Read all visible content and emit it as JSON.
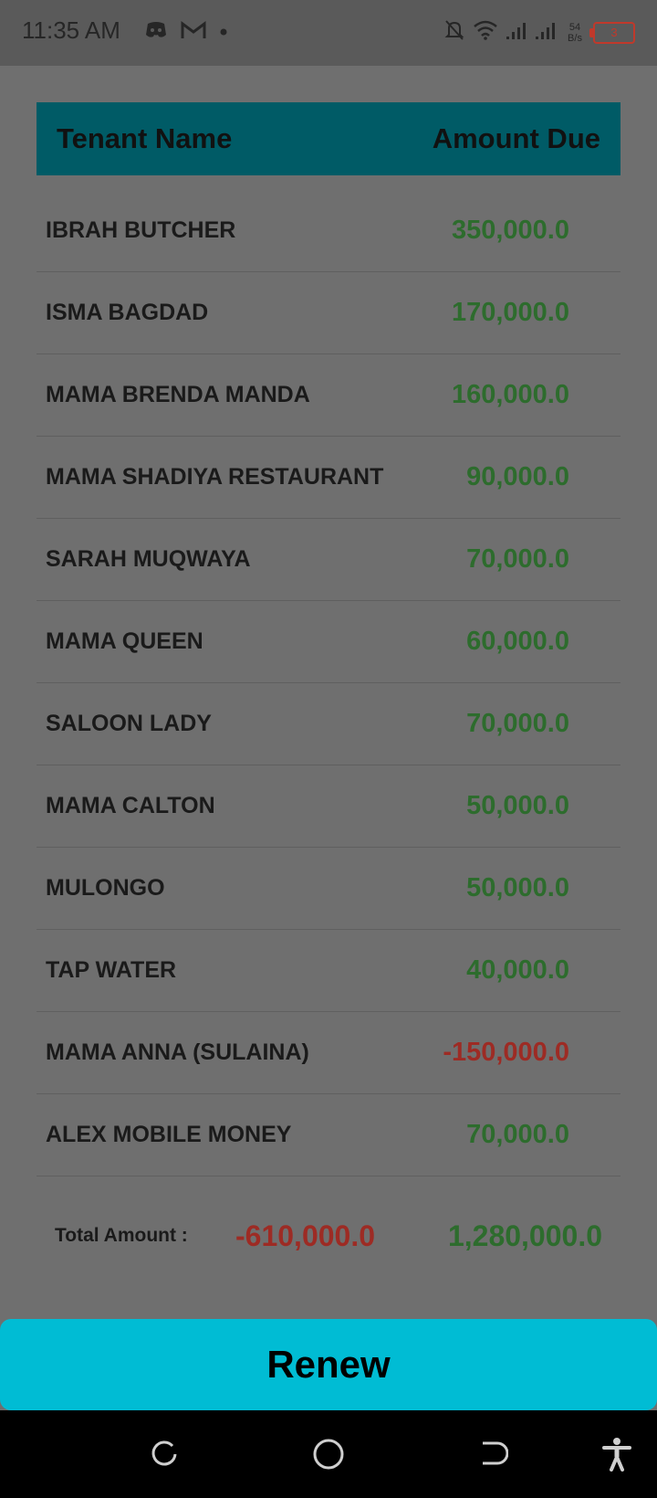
{
  "status_bar": {
    "time": "11:35 AM",
    "net_speed_value": "54",
    "net_speed_unit": "B/s",
    "battery_level": "3",
    "icons": [
      "discord-icon",
      "gmail-icon",
      "notification-dot-icon",
      "bell-off-icon",
      "wifi-icon",
      "signal-icon",
      "signal-icon",
      "battery-icon"
    ]
  },
  "table": {
    "header_name": "Tenant Name",
    "header_amount": "Amount Due",
    "rows": [
      {
        "name": "IBRAH BUTCHER",
        "amount": "350,000.0",
        "status": "positive"
      },
      {
        "name": "ISMA BAGDAD",
        "amount": "170,000.0",
        "status": "positive"
      },
      {
        "name": "MAMA BRENDA MANDA",
        "amount": "160,000.0",
        "status": "positive"
      },
      {
        "name": "MAMA SHADIYA RESTAURANT",
        "amount": "90,000.0",
        "status": "positive"
      },
      {
        "name": "SARAH MUQWAYA",
        "amount": "70,000.0",
        "status": "positive"
      },
      {
        "name": "MAMA QUEEN",
        "amount": "60,000.0",
        "status": "positive"
      },
      {
        "name": "SALOON LADY",
        "amount": "70,000.0",
        "status": "positive"
      },
      {
        "name": "MAMA CALTON",
        "amount": "50,000.0",
        "status": "positive"
      },
      {
        "name": "MULONGO",
        "amount": "50,000.0",
        "status": "positive"
      },
      {
        "name": "TAP WATER",
        "amount": "40,000.0",
        "status": "positive"
      },
      {
        "name": "MAMA ANNA (SULAINA)",
        "amount": "-150,000.0",
        "status": "negative"
      },
      {
        "name": "ALEX MOBILE MONEY",
        "amount": "70,000.0",
        "status": "positive"
      }
    ]
  },
  "total": {
    "label": "Total Amount :",
    "negative_total": "-610,000.0",
    "positive_total": "1,280,000.0"
  },
  "renew_button": {
    "label": "Renew"
  },
  "nav_bar": {
    "icons": [
      "recent-apps-icon",
      "home-icon",
      "back-icon",
      "accessibility-icon"
    ]
  },
  "colors": {
    "header_bg": "#005b66",
    "positive": "#2d6c2d",
    "negative": "#9d2b24",
    "button_bg": "#00bcd4"
  }
}
